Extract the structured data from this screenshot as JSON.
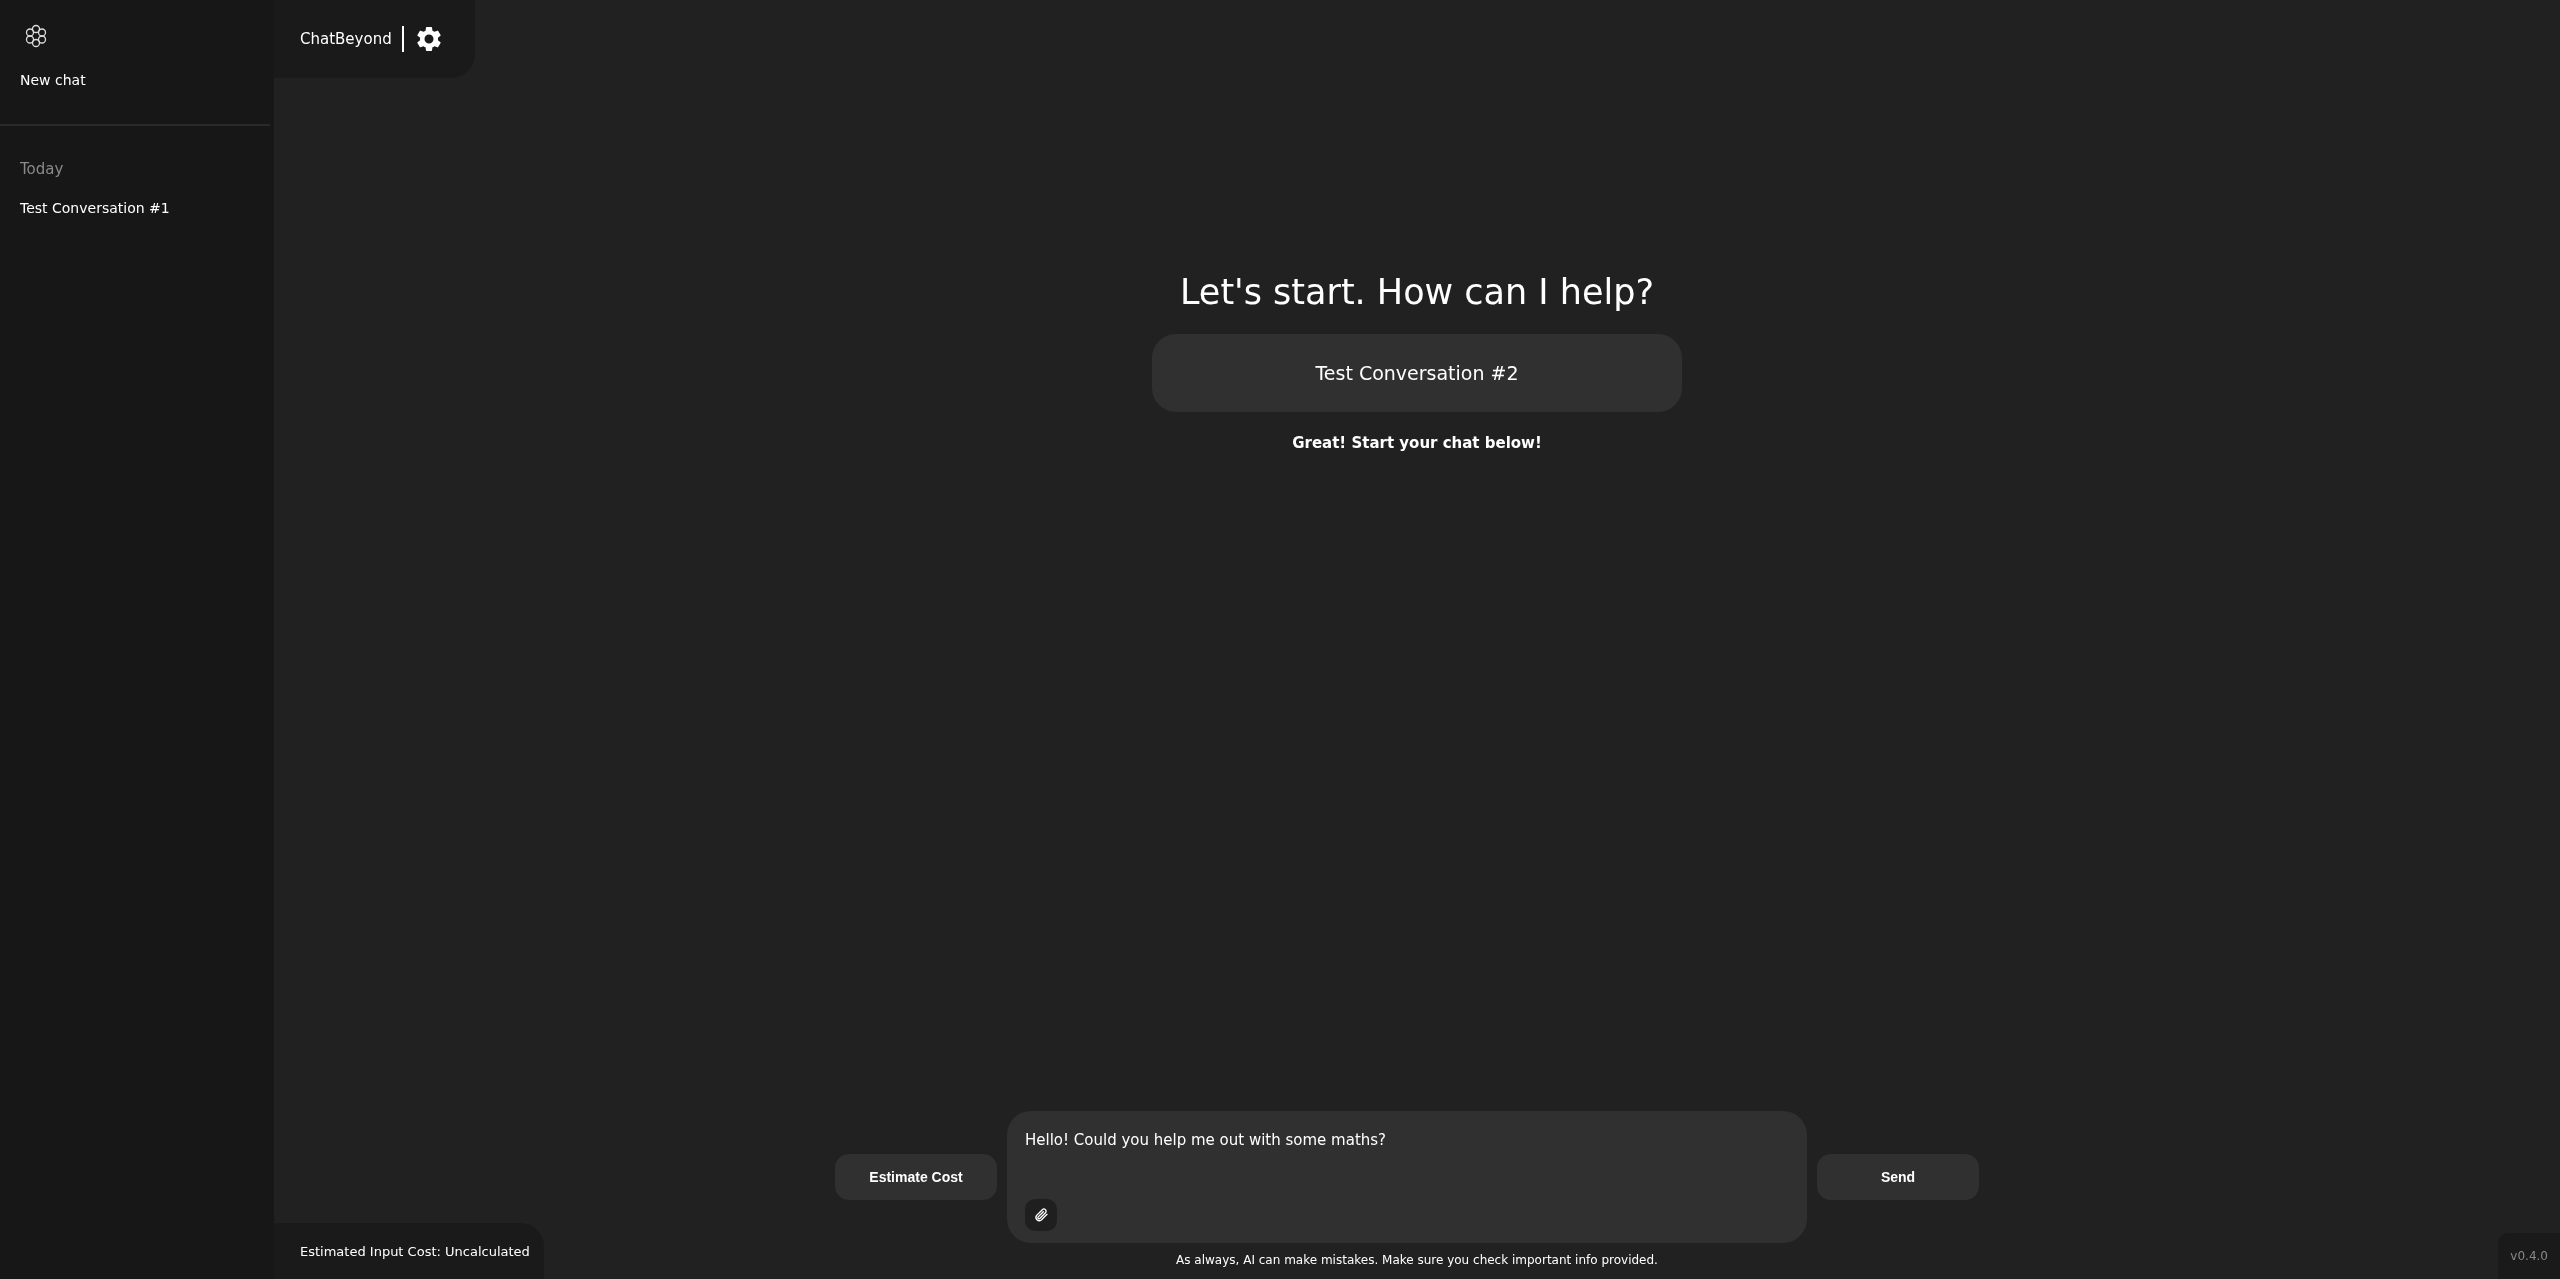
{
  "sidebar": {
    "new_chat": "New chat",
    "sections": [
      {
        "heading": "Today",
        "items": [
          {
            "label": "Test Conversation #1"
          }
        ]
      }
    ]
  },
  "header": {
    "title": "ChatBeyond"
  },
  "main": {
    "heading": "Let's start. How can I help?",
    "conversation_title": "Test Conversation #2",
    "prompt": "Great! Start your chat below!"
  },
  "composer": {
    "estimate_button": "Estimate Cost",
    "message": "Hello! Could you help me out with some maths?",
    "send_button": "Send",
    "disclaimer": "As always, AI can make mistakes. Make sure you check important info provided."
  },
  "cost": "Estimated Input Cost: Uncalculated",
  "version": "v0.4.0"
}
